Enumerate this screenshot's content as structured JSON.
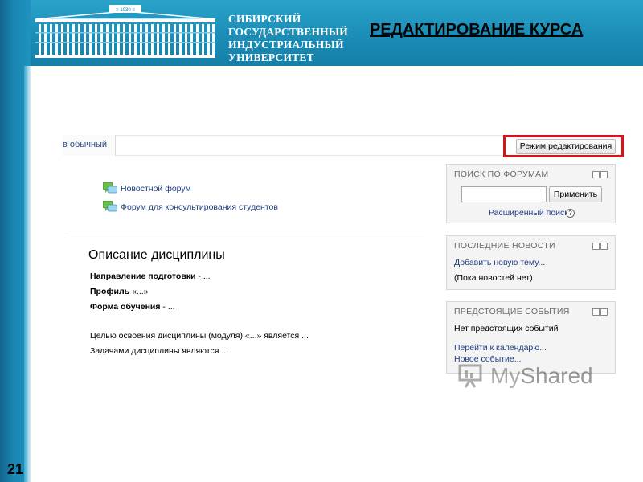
{
  "header": {
    "year_tag": "≡ 1930 ≡",
    "university_name_lines": [
      "СИБИРСКИЙ",
      "ГОСУДАРСТВЕННЫЙ",
      "ИНДУСТРИАЛЬНЫЙ",
      "УНИВЕРСИТЕТ"
    ],
    "slide_title": "РЕДАКТИРОВАНИЕ КУРСА"
  },
  "slide_number": "21",
  "course_page": {
    "view_tab_label": "в обычный",
    "edit_mode_button": "Режим редактирования",
    "forums": [
      {
        "label": "Новостной форум"
      },
      {
        "label": "Форум для консультирования студентов"
      }
    ],
    "section_title": "Описание дисциплины",
    "description": {
      "direction_label": "Направление подготовки",
      "direction_value": " - ...",
      "profile_label": "Профиль",
      "profile_value": " «...»",
      "study_form_label": "Форма обучения",
      "study_form_value": " - ...",
      "goal_text": "Целью освоения дисциплины (модуля) «...» является ...",
      "tasks_text": "Задачами дисциплины являются ..."
    }
  },
  "blocks": {
    "forum_search": {
      "title": "ПОИСК ПО ФОРУМАМ",
      "search_value": "",
      "apply_button": "Применить",
      "advanced_search_link": "Расширенный поиск",
      "help_icon": "?"
    },
    "latest_news": {
      "title": "ПОСЛЕДНИЕ НОВОСТИ",
      "add_topic_link": "Добавить новую тему...",
      "empty_text": "(Пока новостей нет)"
    },
    "upcoming_events": {
      "title": "ПРЕДСТОЯЩИЕ СОБЫТИЯ",
      "empty_text": "Нет предстоящих событий",
      "calendar_link": "Перейти к календарю...",
      "new_event_link": "Новое событие..."
    }
  },
  "watermark": {
    "brand_part1": "My",
    "brand_part2": "Shared"
  },
  "colors": {
    "header_blue": "#1b8db7",
    "link_blue": "#1f3c80",
    "highlight_red": "#d3141b"
  }
}
